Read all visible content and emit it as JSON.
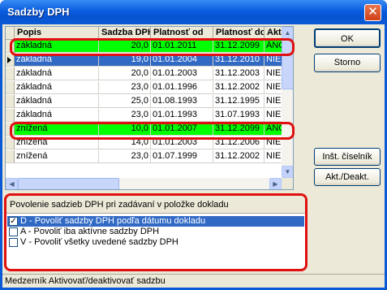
{
  "window": {
    "title": "Sadzby DPH",
    "close_glyph": "✕"
  },
  "grid": {
    "columns": [
      "Popis",
      "Sadzba DPH",
      "Platnosť od",
      "Platnosť do",
      "Akt."
    ],
    "rows": [
      {
        "popis": "základná",
        "sadzba": "20,0",
        "od": "01.01.2011",
        "do": "31.12.2099",
        "akt": "ÁNO",
        "style": "green"
      },
      {
        "popis": "základná",
        "sadzba": "19,0",
        "od": "01.01.2004",
        "do": "31.12.2010",
        "akt": "NIE",
        "style": "sel"
      },
      {
        "popis": "základná",
        "sadzba": "20,0",
        "od": "01.01.2003",
        "do": "31.12.2003",
        "akt": "NIE",
        "style": ""
      },
      {
        "popis": "základná",
        "sadzba": "23,0",
        "od": "01.01.1996",
        "do": "31.12.2002",
        "akt": "NIE",
        "style": ""
      },
      {
        "popis": "základná",
        "sadzba": "25,0",
        "od": "01.08.1993",
        "do": "31.12.1995",
        "akt": "NIE",
        "style": ""
      },
      {
        "popis": "základná",
        "sadzba": "23,0",
        "od": "01.01.1993",
        "do": "31.07.1993",
        "akt": "NIE",
        "style": ""
      },
      {
        "popis": "znížená",
        "sadzba": "10,0",
        "od": "01.01.2007",
        "do": "31.12.2099",
        "akt": "ÁNO",
        "style": "green"
      },
      {
        "popis": "znížená",
        "sadzba": "14,0",
        "od": "01.01.2003",
        "do": "31.12.2006",
        "akt": "NIE",
        "style": ""
      },
      {
        "popis": "znížená",
        "sadzba": "23,0",
        "od": "01.07.1999",
        "do": "31.12.2002",
        "akt": "NIE",
        "style": ""
      }
    ]
  },
  "buttons": {
    "ok": "OK",
    "storno": "Storno",
    "inst_ciselnik": "Inšt. číselník",
    "akt_deakt": "Akt./Deakt."
  },
  "options": {
    "title": "Povolenie sadzieb DPH pri zadávaní v položke dokladu",
    "items": [
      {
        "label": "D - Povoliť sadzby DPH podľa dátumu dokladu",
        "checked": true,
        "selected": true
      },
      {
        "label": "A - Povoliť iba aktívne sadzby DPH",
        "checked": false,
        "selected": false
      },
      {
        "label": "V - Povoliť všetky uvedené sadzby DPH",
        "checked": false,
        "selected": false
      }
    ]
  },
  "status": {
    "text": "Medzerník Aktivovať/deaktivovať sadzbu"
  },
  "colors": {
    "active_row": "#00ff00",
    "selection": "#316ac5",
    "highlight": "#e01010"
  }
}
